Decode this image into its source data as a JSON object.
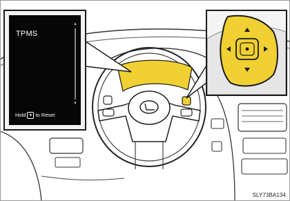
{
  "diagram": {
    "display_panel": {
      "title": "TPMS",
      "hint_prefix": "Hold",
      "hint_key": "●",
      "hint_suffix": "to Reset"
    },
    "image_code": "SLY73BA134",
    "colors": {
      "highlight": "#f0d032",
      "line": "#1a1a1a",
      "screen": "#060606"
    },
    "icons": {
      "brand_emblem": "lexus-emblem-icon",
      "controller": "multi-directional-pad-icon"
    }
  }
}
